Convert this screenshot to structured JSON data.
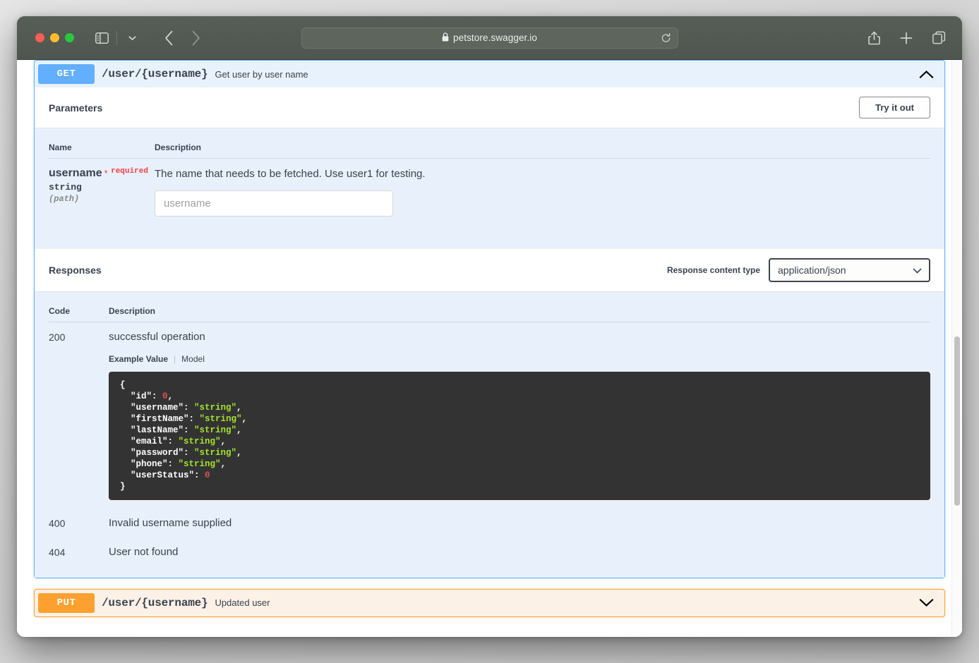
{
  "browser": {
    "url": "petstore.swagger.io",
    "lock_icon": "lock-icon",
    "reload_icon": "reload-icon",
    "back_icon": "back-chevron-icon",
    "forward_icon": "forward-chevron-icon",
    "sidebar_icon": "sidebar-toggle-icon",
    "sidebar_dropdown_icon": "chevron-down-icon",
    "share_icon": "share-icon",
    "new_tab_icon": "plus-icon",
    "tabs_overview_icon": "tab-overview-icon",
    "traffic_lights": [
      "close-red",
      "minimize-yellow",
      "zoom-green"
    ]
  },
  "operations": [
    {
      "method": "GET",
      "method_color": "#61affe",
      "path": "/user/{username}",
      "summary": "Get user by user name",
      "expanded": true,
      "toggle_icon": "chevron-up-icon",
      "parameters_section": {
        "title": "Parameters",
        "try_it_out_label": "Try it out",
        "columns": [
          "Name",
          "Description"
        ],
        "rows": [
          {
            "name": "username",
            "required_star": "*",
            "required_label": "required",
            "type": "string",
            "in": "(path)",
            "description": "The name that needs to be fetched. Use user1 for testing.",
            "input_value": "",
            "input_placeholder": "username"
          }
        ]
      },
      "responses_section": {
        "title": "Responses",
        "content_type_label": "Response content type",
        "content_type_value": "application/json",
        "content_type_caret": "chevron-down-icon",
        "columns": [
          "Code",
          "Description"
        ],
        "rows": [
          {
            "code": "200",
            "description": "successful operation",
            "tabs": {
              "active": "Example Value",
              "inactive": "Model"
            },
            "example_lines": [
              {
                "text": "{"
              },
              {
                "indent": true,
                "key": "\"id\"",
                "sep": ": ",
                "value": "0",
                "value_type": "number",
                "trail": ","
              },
              {
                "indent": true,
                "key": "\"username\"",
                "sep": ": ",
                "value": "\"string\"",
                "value_type": "string",
                "trail": ","
              },
              {
                "indent": true,
                "key": "\"firstName\"",
                "sep": ": ",
                "value": "\"string\"",
                "value_type": "string",
                "trail": ","
              },
              {
                "indent": true,
                "key": "\"lastName\"",
                "sep": ": ",
                "value": "\"string\"",
                "value_type": "string",
                "trail": ","
              },
              {
                "indent": true,
                "key": "\"email\"",
                "sep": ": ",
                "value": "\"string\"",
                "value_type": "string",
                "trail": ","
              },
              {
                "indent": true,
                "key": "\"password\"",
                "sep": ": ",
                "value": "\"string\"",
                "value_type": "string",
                "trail": ","
              },
              {
                "indent": true,
                "key": "\"phone\"",
                "sep": ": ",
                "value": "\"string\"",
                "value_type": "string",
                "trail": ","
              },
              {
                "indent": true,
                "key": "\"userStatus\"",
                "sep": ": ",
                "value": "0",
                "value_type": "number",
                "trail": ""
              },
              {
                "text": "}"
              }
            ]
          },
          {
            "code": "400",
            "description": "Invalid username supplied"
          },
          {
            "code": "404",
            "description": "User not found"
          }
        ]
      }
    },
    {
      "method": "PUT",
      "method_color": "#fca130",
      "path": "/user/{username}",
      "summary": "Updated user",
      "expanded": false,
      "toggle_icon": "chevron-down-icon"
    }
  ],
  "colors": {
    "get_accent": "#61affe",
    "put_accent": "#fca130",
    "required": "#f93e3e",
    "code_string": "#a5e22d",
    "code_number": "#d9534f",
    "panel_bg": "#e8f0fb",
    "code_bg": "#333333"
  }
}
